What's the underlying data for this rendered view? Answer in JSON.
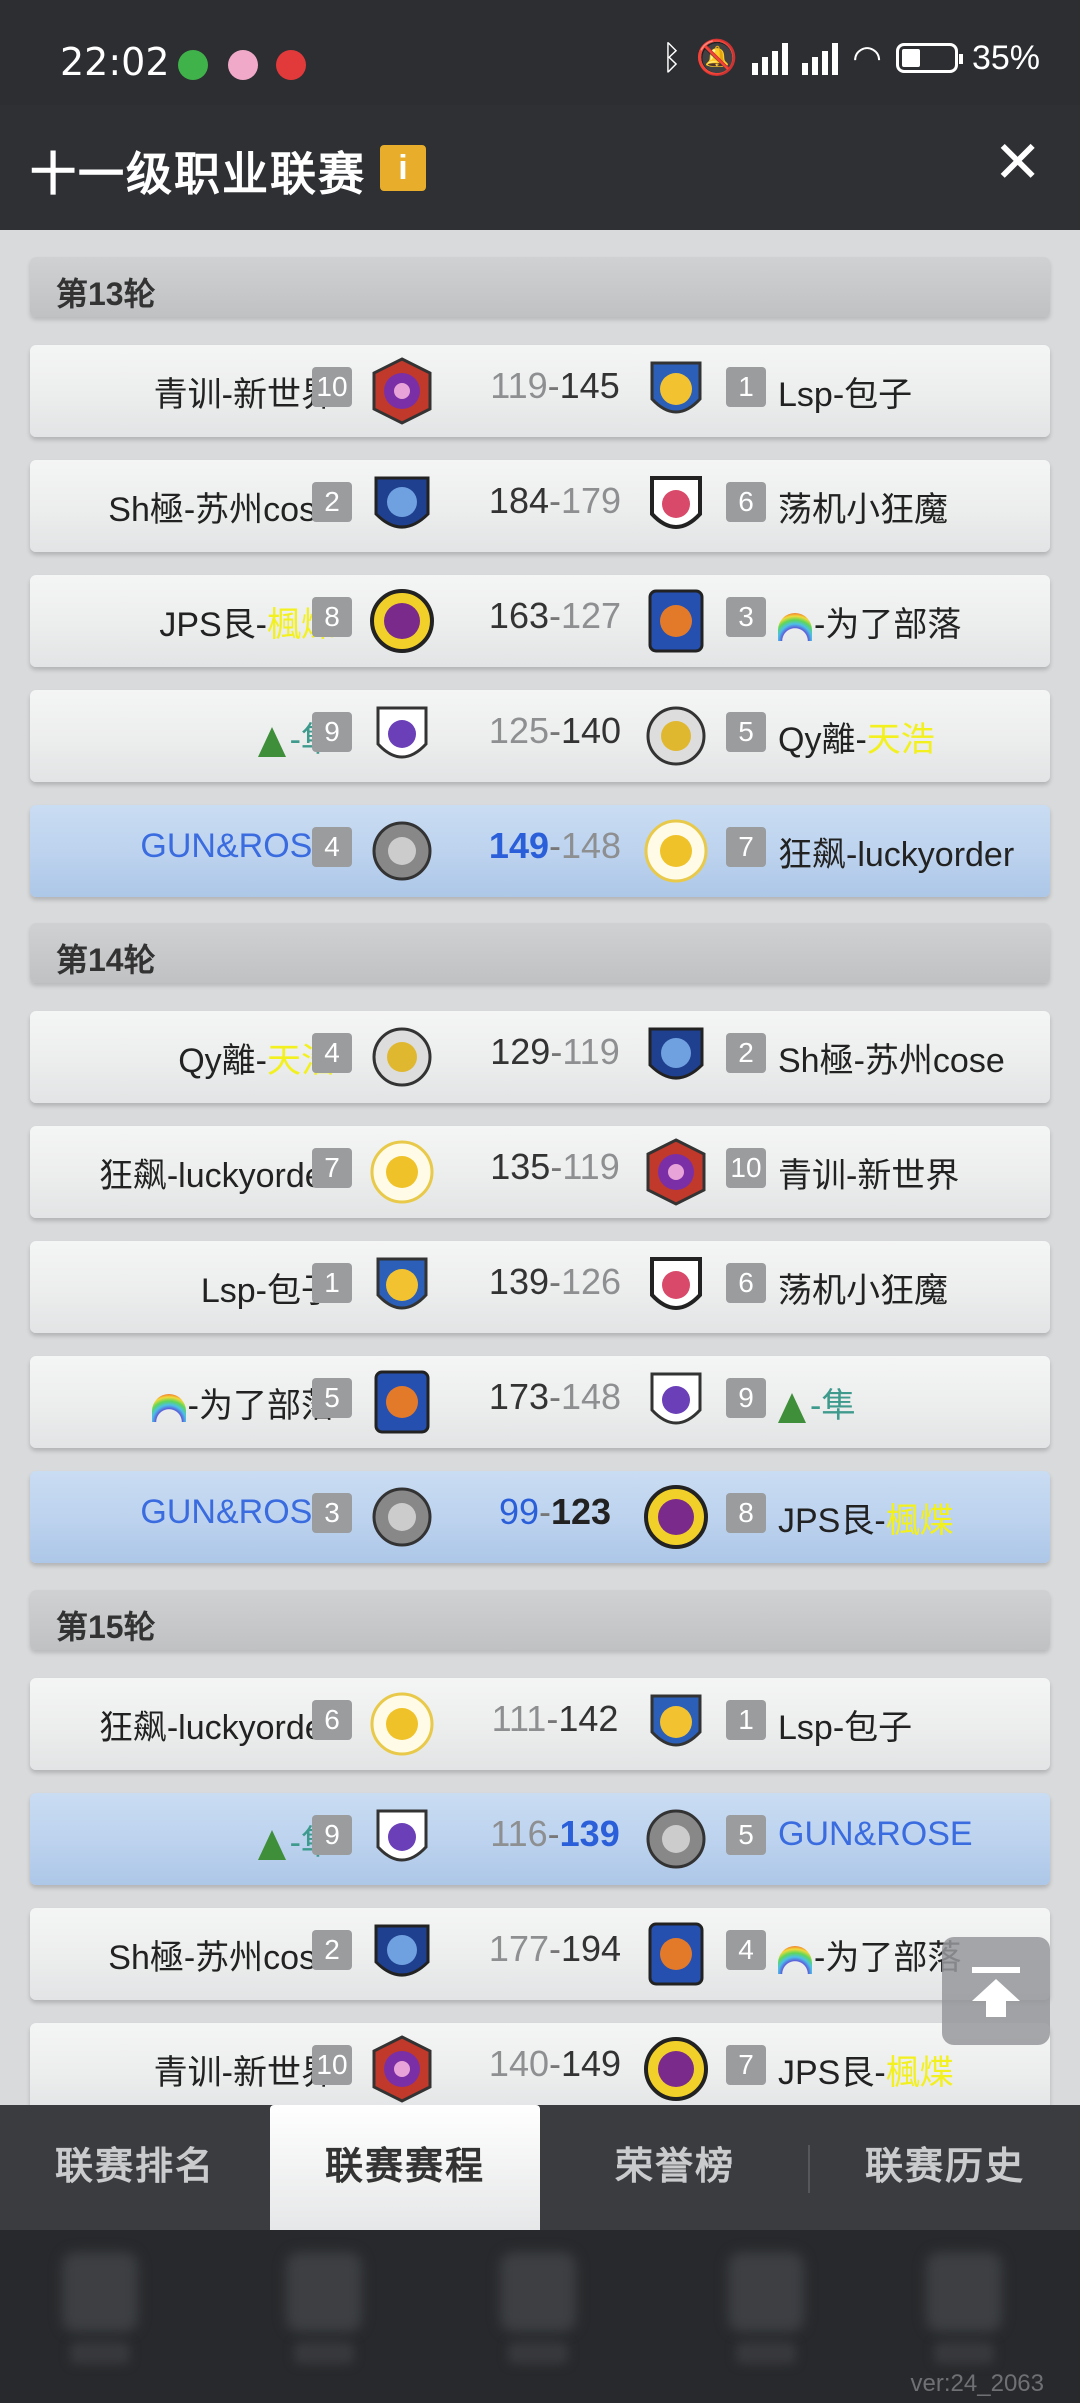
{
  "status_bar": {
    "time": "22:02",
    "battery": "35%"
  },
  "header": {
    "title": "十一级职业联赛",
    "info_icon": "i",
    "close": "✕"
  },
  "rounds": [
    {
      "label": "第13轮",
      "matches": [
        {
          "home": "青训-新世界",
          "home_seed": "10",
          "home_score": "119",
          "away_score": "145",
          "away": "Lsp-包子",
          "away_seed": "1"
        },
        {
          "home": "Sh極-苏州cose",
          "home_seed": "2",
          "home_score": "184",
          "away_score": "179",
          "away": "荡机小狂魔",
          "away_seed": "6"
        },
        {
          "home_prefix": "JPS艮-",
          "home_suffix": "楓煠",
          "home_seed": "8",
          "home_score": "163",
          "away_score": "127",
          "away": "-为了部落",
          "away_seed": "3"
        },
        {
          "home": "-隼",
          "home_seed": "9",
          "home_score": "125",
          "away_score": "140",
          "away_prefix": "Qy離-",
          "away_suffix": "天浩",
          "away_seed": "5"
        },
        {
          "home": "GUN&ROSE",
          "home_seed": "4",
          "home_score": "149",
          "away_score": "148",
          "away": "狂飙-luckyorder",
          "away_seed": "7"
        }
      ]
    },
    {
      "label": "第14轮",
      "matches": [
        {
          "home_prefix": "Qy離-",
          "home_suffix": "天浩",
          "home_seed": "4",
          "home_score": "129",
          "away_score": "119",
          "away": "Sh極-苏州cose",
          "away_seed": "2"
        },
        {
          "home": "狂飙-luckyorder",
          "home_seed": "7",
          "home_score": "135",
          "away_score": "119",
          "away": "青训-新世界",
          "away_seed": "10"
        },
        {
          "home": "Lsp-包子",
          "home_seed": "1",
          "home_score": "139",
          "away_score": "126",
          "away": "荡机小狂魔",
          "away_seed": "6"
        },
        {
          "home": "-为了部落",
          "home_seed": "5",
          "home_score": "173",
          "away_score": "148",
          "away": "-隼",
          "away_seed": "9"
        },
        {
          "home": "GUN&ROSE",
          "home_seed": "3",
          "home_score": "99",
          "away_score": "123",
          "away_prefix": "JPS艮-",
          "away_suffix": "楓煠",
          "away_seed": "8"
        }
      ]
    },
    {
      "label": "第15轮",
      "matches": [
        {
          "home": "狂飙-luckyorder",
          "home_seed": "6",
          "home_score": "111",
          "away_score": "142",
          "away": "Lsp-包子",
          "away_seed": "1"
        },
        {
          "home": "-隼",
          "home_seed": "9",
          "home_score": "116",
          "away_score": "139",
          "away": "GUN&ROSE",
          "away_seed": "5"
        },
        {
          "home": "Sh極-苏州cose",
          "home_seed": "2",
          "home_score": "177",
          "away_score": "194",
          "away": "-为了部落",
          "away_seed": "4"
        },
        {
          "home": "青训-新世界",
          "home_seed": "10",
          "home_score": "140",
          "away_score": "149",
          "away_prefix": "JPS艮-",
          "away_suffix": "楓煠",
          "away_seed": "7"
        }
      ]
    }
  ],
  "score_separator": "-",
  "tabs": [
    "联赛排名",
    "联赛赛程",
    "荣誉榜",
    "联赛历史"
  ],
  "active_tab": "联赛赛程",
  "version": "ver:24_2063",
  "colors": {
    "highlight_blue": "#3a6ce0",
    "yellow_name": "#f2f01e",
    "accent_info": "#e8ad2a"
  },
  "icons": [
    "bluetooth-icon",
    "mute-icon",
    "signal-icon",
    "wifi-icon",
    "battery-icon",
    "info-icon",
    "close-icon",
    "scroll-top-icon",
    "team-badge-icon"
  ]
}
